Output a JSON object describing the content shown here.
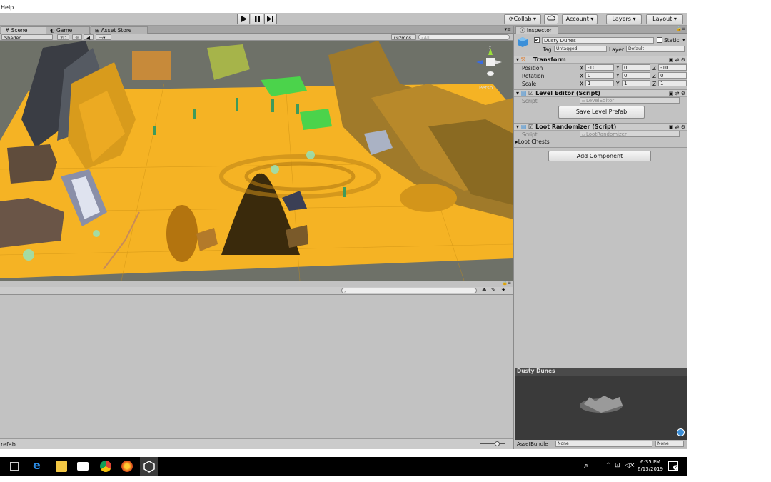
{
  "menubar": {
    "help_label": "Help"
  },
  "toolbar": {
    "collab_label": "Collab ▾",
    "account_label": "Account",
    "layers_label": "Layers",
    "layout_label": "Layout"
  },
  "scene_panel": {
    "tabs": [
      {
        "label": "# Scene"
      },
      {
        "label": "Game"
      },
      {
        "label": "Asset Store"
      }
    ],
    "shading_mode": "Shaded",
    "mode_2d": "2D",
    "gizmos_label": "Gizmos ▾",
    "search_placeholder": "All",
    "persp_label": "Persp"
  },
  "bottom_panel": {
    "status_text": "refab"
  },
  "inspector": {
    "tab_label": "Inspector",
    "object_name": "Dusty Dunes",
    "static_label": "Static",
    "tag_label": "Tag",
    "tag_value": "Untagged",
    "layer_label": "Layer",
    "layer_value": "Default",
    "transform": {
      "title": "Transform",
      "position_label": "Position",
      "rotation_label": "Rotation",
      "scale_label": "Scale",
      "position": {
        "x": "-10",
        "y": "0",
        "z": "-10"
      },
      "rotation": {
        "x": "0",
        "y": "0",
        "z": "0"
      },
      "scale": {
        "x": "1",
        "y": "1",
        "z": "1"
      }
    },
    "level_editor": {
      "title": "Level Editor (Script)",
      "script_label": "Script",
      "script_value": "LevelEditor",
      "button_label": "Save Level Prefab"
    },
    "loot_randomizer": {
      "title": "Loot Randomizer (Script)",
      "script_label": "Script",
      "script_value": "LootRandomizer",
      "chests_label": "Loot Chests"
    },
    "add_component_label": "Add Component",
    "preview_title": "Dusty Dunes",
    "assetbundle_label": "AssetBundle",
    "assetbundle_value": "None",
    "assetbundle_variant": "None"
  },
  "taskbar": {
    "time": "6:35 PM",
    "date": "6/13/2019",
    "notification_count": "2"
  },
  "colors": {
    "terrain": "#f5b324",
    "viewport_bg": "#6e7168",
    "panel_bg": "#c2c2c2",
    "taskbar_bg": "#000000"
  }
}
